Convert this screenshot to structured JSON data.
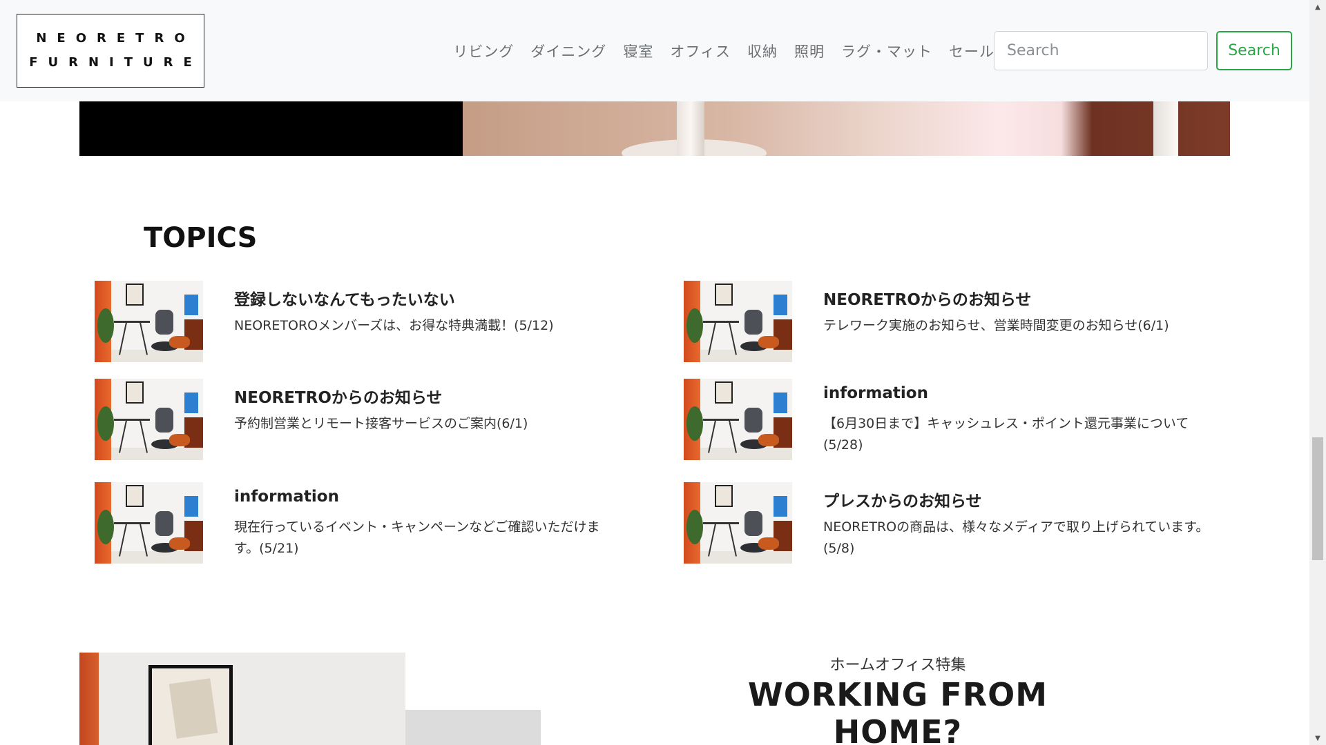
{
  "brand": {
    "line1": "NEORETRO",
    "line2": "FURNITURE"
  },
  "nav": {
    "items": [
      {
        "label": "リビング"
      },
      {
        "label": "ダイニング"
      },
      {
        "label": "寝室"
      },
      {
        "label": "オフィス"
      },
      {
        "label": "収納"
      },
      {
        "label": "照明"
      },
      {
        "label": "ラグ・マット"
      },
      {
        "label": "セール"
      }
    ],
    "search_placeholder": "Search",
    "search_button": "Search"
  },
  "colors": {
    "accent": "#28a745",
    "navbar_bg": "#f8f9fa"
  },
  "topics": {
    "heading": "TOPICS",
    "items": [
      {
        "title": "登録しないなんてもったいない",
        "desc": "NEORETOROメンバーズは、お得な特典満載！(5/12)",
        "icon": "home-office-thumbnail"
      },
      {
        "title": "NEORETROからのお知らせ",
        "desc": "テレワーク実施のお知らせ、営業時間変更のお知らせ(6/1)",
        "icon": "home-office-thumbnail"
      },
      {
        "title": "NEORETROからのお知らせ",
        "desc": "予約制営業とリモート接客サービスのご案内(6/1)",
        "icon": "home-office-thumbnail"
      },
      {
        "title": "information",
        "desc": "【6月30日まで】キャッシュレス・ポイント還元事業について(5/28)",
        "icon": "home-office-thumbnail"
      },
      {
        "title": "information",
        "desc": "現在行っているイベント・キャンペーンなどご確認いただけます。(5/21)",
        "icon": "home-office-thumbnail"
      },
      {
        "title": "プレスからのお知らせ",
        "desc": "NEORETROの商品は、様々なメディアで取り上げられています。(5/8)",
        "icon": "home-office-thumbnail"
      }
    ]
  },
  "feature": {
    "subtitle": "ホームオフィス特集",
    "title": "WORKING FROM HOME?"
  }
}
